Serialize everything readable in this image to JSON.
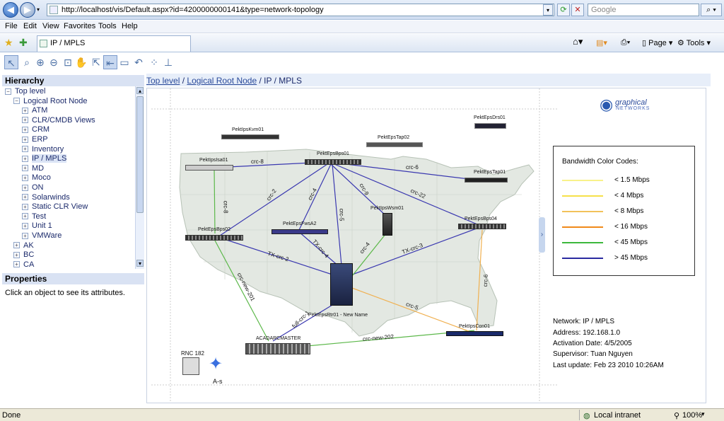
{
  "browser": {
    "url": "http://localhost/vis/Default.aspx?id=4200000000141&type=network-topology",
    "search_placeholder": "Google",
    "tab_title": "IP / MPLS",
    "page_label": "Page",
    "tools_label": "Tools"
  },
  "menu": [
    "File",
    "Edit",
    "View",
    "Favorites",
    "Tools",
    "Help"
  ],
  "left": {
    "hierarchy_title": "Hierarchy",
    "properties_title": "Properties",
    "properties_hint": "Click an object to see its attributes.",
    "tree": [
      {
        "label": "Top level",
        "expander": "−",
        "level": 0
      },
      {
        "label": "Logical Root Node",
        "expander": "−",
        "level": 1
      },
      {
        "label": "ATM",
        "expander": "+",
        "level": 2
      },
      {
        "label": "CLR/CMDB Views",
        "expander": "+",
        "level": 2
      },
      {
        "label": "CRM",
        "expander": "+",
        "level": 2
      },
      {
        "label": "ERP",
        "expander": "+",
        "level": 2
      },
      {
        "label": "Inventory",
        "expander": "+",
        "level": 2
      },
      {
        "label": "IP / MPLS",
        "expander": "+",
        "level": 2
      },
      {
        "label": "MD",
        "expander": "+",
        "level": 2
      },
      {
        "label": "Moco",
        "expander": "+",
        "level": 2
      },
      {
        "label": "ON",
        "expander": "+",
        "level": 2
      },
      {
        "label": "Solarwinds",
        "expander": "+",
        "level": 2
      },
      {
        "label": "Static CLR View",
        "expander": "+",
        "level": 2
      },
      {
        "label": "Test",
        "expander": "+",
        "level": 2
      },
      {
        "label": "Unit 1",
        "expander": "+",
        "level": 2
      },
      {
        "label": "VMWare",
        "expander": "+",
        "level": 2
      },
      {
        "label": "AK",
        "expander": "+",
        "level": 1
      },
      {
        "label": "BC",
        "expander": "+",
        "level": 1
      },
      {
        "label": "CA",
        "expander": "+",
        "level": 1
      }
    ]
  },
  "breadcrumb": {
    "top": "Top level",
    "root": "Logical Root Node",
    "current": "IP / MPLS",
    "sep": "/"
  },
  "logo": {
    "line1": "graphical",
    "line2": "NETWORKS"
  },
  "legend": {
    "title": "Bandwidth Color Codes:",
    "items": [
      {
        "label": "< 1.5 Mbps",
        "color": "#f8f28a"
      },
      {
        "label": "< 4 Mbps",
        "color": "#f6e04a"
      },
      {
        "label": "< 8 Mbps",
        "color": "#f2c25a"
      },
      {
        "label": "< 16 Mbps",
        "color": "#f08a1a"
      },
      {
        "label": "< 45 Mbps",
        "color": "#3cb83c"
      },
      {
        "label": "> 45 Mbps",
        "color": "#2a2aa0"
      }
    ]
  },
  "info": {
    "network": "Network: IP / MPLS",
    "address": "Address: 192.168.1.0",
    "activation": "Activation Date: 4/5/2005",
    "supervisor": "Supervisor: Tuan Nguyen",
    "updated": "Last update: Feb 23 2010 10:26AM"
  },
  "devices": {
    "kvm": "PektIpsKvm01",
    "tap02": "PektEpsTap02",
    "drs": "PektEpsDrs01",
    "isa": "PektIpsIsa01",
    "bps01": "PektEpsBps01",
    "tap01": "PektEpsTap01",
    "wsm": "PektIpsWsm01",
    "bps04": "PektEpsBps04",
    "bps02": "PektEpsBps02",
    "fwsa2": "PektEpsFwsA2",
    "rtr": "PektEpsRtr01 - New Name",
    "con": "PektIpsCon01",
    "acad": "ACADARCMASTER",
    "rnc": "RNC 182",
    "as": "A-s"
  },
  "links": {
    "crc8a": "crc-8",
    "crc6": "crc-6",
    "crc2": "crc-2",
    "crc4a": "crc-4",
    "crc9": "crc-9",
    "crc22": "crc-22",
    "crc8b": "crc-8",
    "crc5a": "crc-5",
    "tx2": "TX-crc-2",
    "tx4": "TX-crc-4",
    "crc4b": "crc-4",
    "tx3": "TX-crc-3",
    "crc6b": "crc-6",
    "crc5b": "crc-5",
    "new201": "crc-new-201",
    "full1": "full-crc-1",
    "new202": "crc-new-202"
  },
  "status": {
    "left": "Done",
    "zone": "Local intranet",
    "zoom": "100%"
  },
  "colors": {
    "accent": "#2a4a9a",
    "link_blue": "#3a38b0",
    "link_green": "#5cb84a",
    "link_orange": "#f0b050"
  }
}
